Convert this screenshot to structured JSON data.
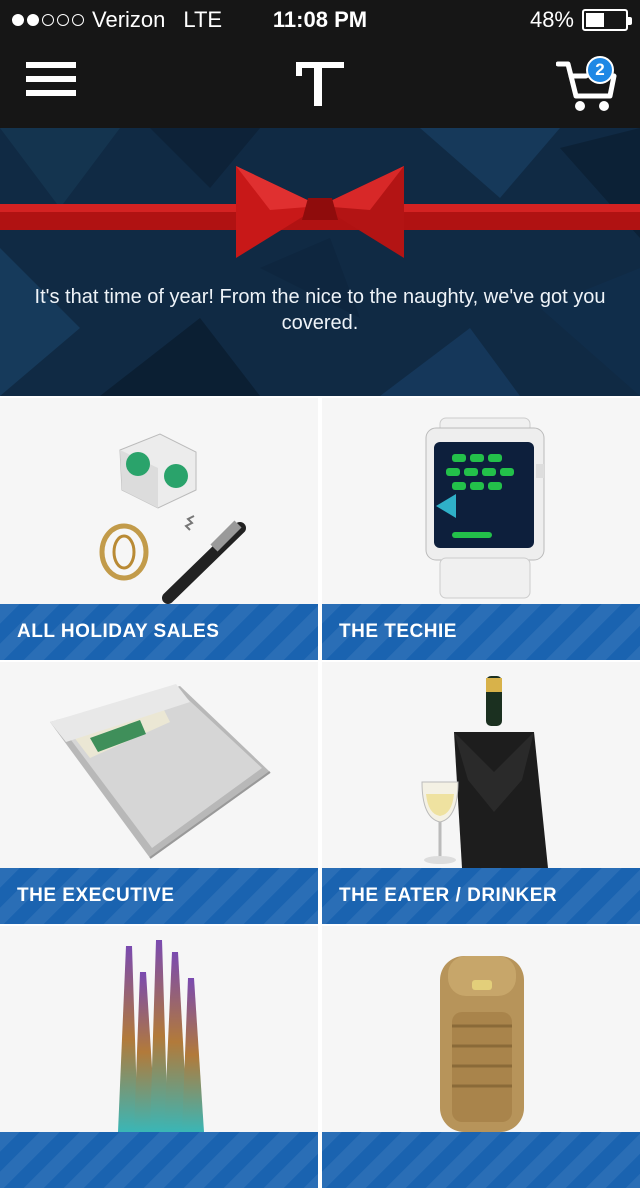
{
  "status_bar": {
    "carrier": "Verizon",
    "network": "LTE",
    "time": "11:08 PM",
    "battery": "48%",
    "battery_level": 0.48,
    "signal_bars_filled": 2,
    "signal_bars_total": 5
  },
  "nav": {
    "menu_icon": "hamburger-icon",
    "logo_letter": "T",
    "cart_icon": "cart-icon",
    "cart_count": "2"
  },
  "banner": {
    "text": "It's that time of year! From the nice to the naughty, we've got you covered."
  },
  "categories": [
    {
      "label": "ALL HOLIDAY SALES"
    },
    {
      "label": "THE TECHIE"
    },
    {
      "label": "THE EXECUTIVE"
    },
    {
      "label": "THE EATER / DRINKER"
    },
    {
      "label": ""
    },
    {
      "label": ""
    }
  ],
  "colors": {
    "bar_bg": "#161616",
    "banner_bg": "#102a44",
    "ribbon": "#c41414",
    "label_blue": "#1a63b0",
    "badge_blue": "#1e88e5"
  }
}
